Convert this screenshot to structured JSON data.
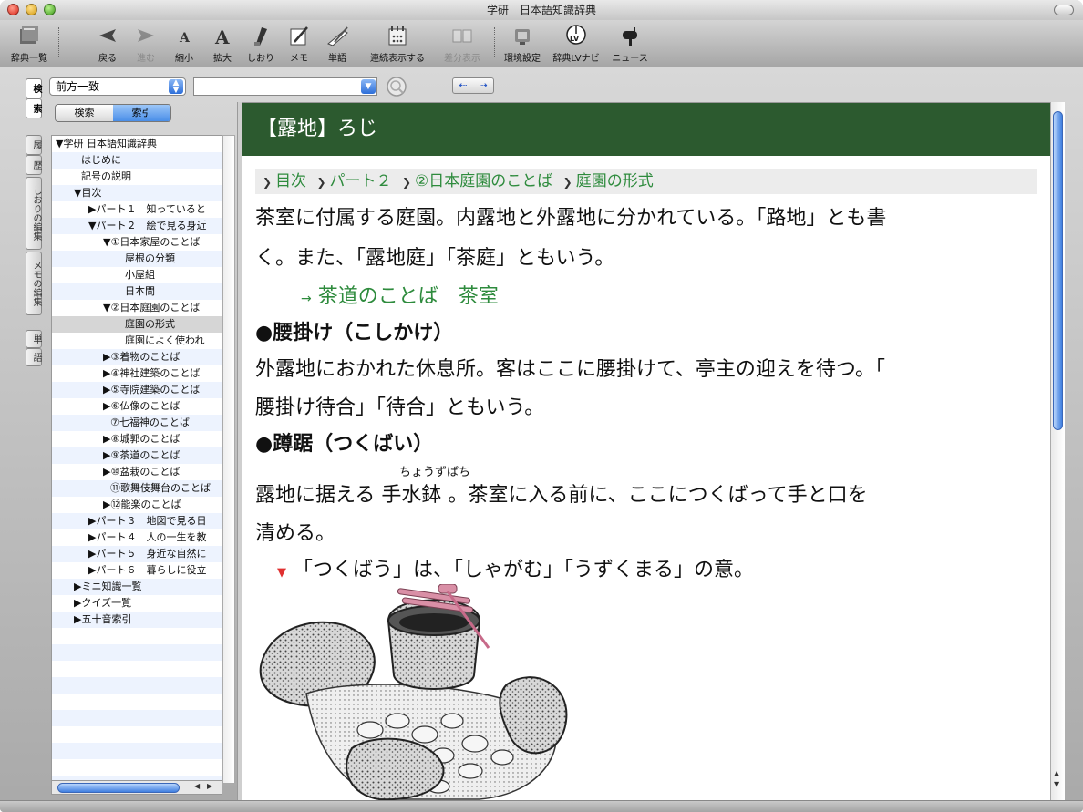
{
  "window": {
    "title": "学研　日本語知識辞典"
  },
  "toolbar": {
    "items": [
      {
        "label": "辞典一覧",
        "icon": "book-list-icon"
      },
      {
        "label": "戻る",
        "icon": "arrow-left-icon"
      },
      {
        "label": "進む",
        "icon": "arrow-right-icon"
      },
      {
        "label": "縮小",
        "icon": "font-smaller-icon"
      },
      {
        "label": "拡大",
        "icon": "font-larger-icon"
      },
      {
        "label": "しおり",
        "icon": "bookmark-icon"
      },
      {
        "label": "メモ",
        "icon": "memo-icon"
      },
      {
        "label": "単語",
        "icon": "word-icon"
      },
      {
        "label": "連続表示する",
        "icon": "continuous-view-icon"
      },
      {
        "label": "差分表示",
        "icon": "diff-view-icon"
      },
      {
        "label": "環境設定",
        "icon": "preferences-icon"
      },
      {
        "label": "辞典LVナビ",
        "icon": "lv-navi-icon"
      },
      {
        "label": "ニュース",
        "icon": "news-mailbox-icon"
      }
    ]
  },
  "search": {
    "mode": "前方一致",
    "query": "",
    "arrows": [
      "⇠",
      "⇢"
    ]
  },
  "sidetabs": [
    "検",
    "索",
    "履",
    "歴",
    "しおりの編集",
    "メモの編集",
    "単",
    "語"
  ],
  "leftpanel": {
    "seg_search": "検索",
    "seg_index": "索引",
    "tree": [
      "▼学研 日本語知識辞典",
      "はじめに",
      "記号の説明",
      "▼目次",
      "▶パート１　知っていると",
      "▼パート２　絵で見る身近",
      "▼①日本家屋のことば",
      "屋根の分類",
      "小屋組",
      "日本間",
      "▼②日本庭園のことば",
      "庭園の形式",
      "庭園によく使われ",
      "▶③着物のことば",
      "▶④神社建築のことば",
      "▶⑤寺院建築のことば",
      "▶⑥仏像のことば",
      "⑦七福神のことば",
      "▶⑧城郭のことば",
      "▶⑨茶道のことば",
      "▶⑩盆栽のことば",
      "⑪歌舞伎舞台のことば",
      "▶⑫能楽のことば",
      "▶パート３　地図で見る日",
      "▶パート４　人の一生を教",
      "▶パート５　身近な自然に",
      "▶パート６　暮らしに役立",
      "▶ミニ知識一覧",
      "▶クイズ一覧",
      "▶五十音索引"
    ]
  },
  "entry": {
    "headword": "【露地】ろじ",
    "breadcrumbs": [
      "目次",
      "パート２",
      "②日本庭園のことば",
      "庭園の形式"
    ],
    "line1": "茶室に付属する庭園。内露地と外露地に分かれている。「路地」とも書",
    "line2": "く。また、「露地庭」「茶庭」ともいう。",
    "see_also": "茶道のことば　茶室",
    "heading1": "●腰掛け（こしかけ）",
    "line3": "外露地におかれた休息所。客はここに腰掛けて、亭主の迎えを待つ。「",
    "line4": "腰掛け待合」「待合」ともいう。",
    "heading2": "●蹲踞（つくばい）",
    "ruby": "ちょうずばち",
    "line5": "露地に据える 手水鉢 。茶室に入る前に、ここにつくばって手と口を",
    "line6": "清める。",
    "note": "「つくばう」は、「しゃがむ」「うずくまる」の意。",
    "illustration": "tsukubai-illustration"
  },
  "colors": {
    "headword_bg": "#2c5a2f",
    "link_green": "#2e8b3d",
    "note_red": "#e03030"
  }
}
